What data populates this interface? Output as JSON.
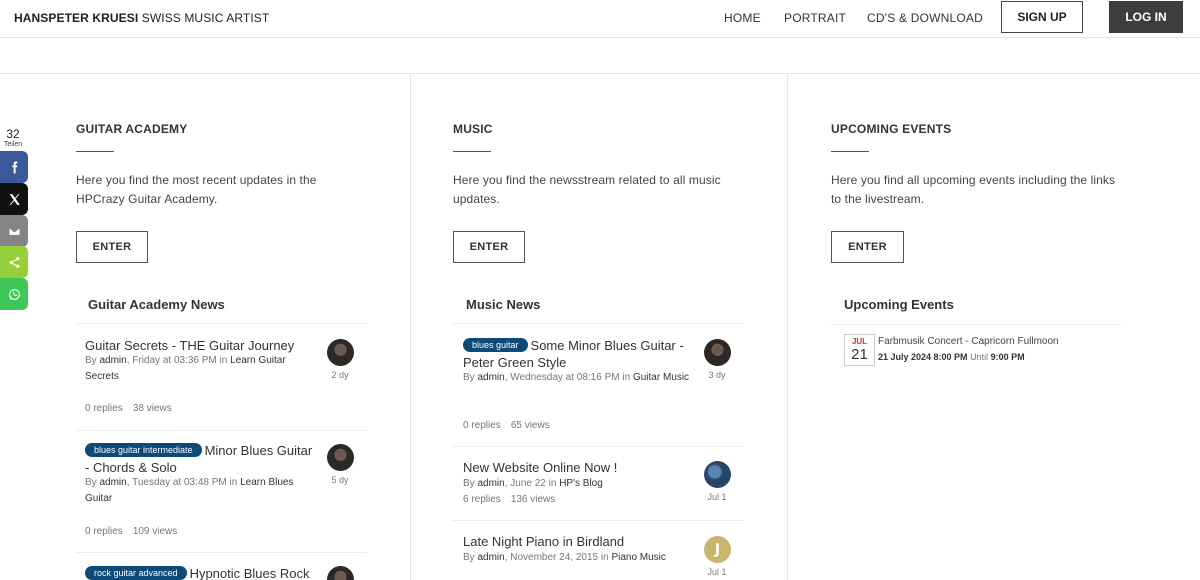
{
  "header": {
    "brand_bold": "HANSPETER KRUESI",
    "brand_rest": " SWISS MUSIC ARTIST",
    "nav": [
      "HOME",
      "PORTRAIT",
      "CD'S & DOWNLOAD"
    ],
    "signup": "SIGN UP",
    "login": "LOG IN"
  },
  "share": {
    "count": "32",
    "label": "Teilen",
    "buttons": [
      {
        "name": "facebook",
        "color": "#3b5998"
      },
      {
        "name": "x",
        "color": "#111111"
      },
      {
        "name": "email",
        "color": "#848484"
      },
      {
        "name": "share",
        "color": "#95d03a"
      },
      {
        "name": "whatsapp",
        "color": "#3ec757"
      }
    ]
  },
  "sections": [
    {
      "title": "GUITAR ACADEMY",
      "desc": "Here you find the most recent updates in the HPCrazy Guitar Academy.",
      "enter": "ENTER",
      "news_title": "Guitar Academy News",
      "items": [
        {
          "tag": "",
          "title": "Guitar Secrets - THE Guitar Journey",
          "by": "By ",
          "author": "admin",
          "when": ", Friday at 03:36 PM",
          "in": " in ",
          "forum": "Learn Guitar Secrets",
          "replies": "0 replies",
          "views": "38 views",
          "age": "2 dy"
        },
        {
          "tag": "blues guitar intermediate",
          "title": "Minor Blues Guitar - Chords & Solo",
          "by": "By ",
          "author": "admin",
          "when": ", Tuesday at 03:48 PM",
          "in": " in ",
          "forum": "Learn Blues Guitar",
          "replies": "0 replies",
          "views": "109 views",
          "age": "5 dy"
        },
        {
          "tag": "rock guitar advanced",
          "title": "Hypnotic Blues Rock",
          "by": "",
          "author": "",
          "when": "",
          "in": "",
          "forum": "",
          "replies": "",
          "views": "",
          "age": ""
        }
      ]
    },
    {
      "title": "MUSIC",
      "desc": "Here you find the newsstream related to all music updates.",
      "enter": "ENTER",
      "news_title": "Music News",
      "items": [
        {
          "tag": "blues guitar",
          "title": "Some Minor Blues Guitar - Peter Green Style",
          "by": "By ",
          "author": "admin",
          "when": ", Wednesday at 08:16 PM",
          "in": " in ",
          "forum": "Guitar Music",
          "replies": "0 replies",
          "views": "65 views",
          "age": "3 dy"
        },
        {
          "tag": "",
          "title": "New Website Online Now !",
          "by": "By ",
          "author": "admin",
          "when": ", June 22",
          "in": " in ",
          "forum": "HP's Blog",
          "replies": "6 replies",
          "views": "136 views",
          "age": "Jul 1"
        },
        {
          "tag": "",
          "title": "Late Night Piano in Birdland",
          "by": "By ",
          "author": "admin",
          "when": ", November 24, 2015",
          "in": " in ",
          "forum": "Piano Music",
          "replies": "",
          "views": "",
          "age": "Jul 1",
          "avatar_letter": "J"
        }
      ]
    },
    {
      "title": "UPCOMING EVENTS",
      "desc": "Here you find all upcoming events including the links to the livestream.",
      "enter": "ENTER",
      "news_title": "Upcoming Events",
      "event": {
        "month": "JUL",
        "day": "21",
        "title": "Farbmusik Concert - Capricorn Fullmoon",
        "start": "21 July 2024 8:00 PM",
        "until": " Until ",
        "end": "9:00 PM"
      }
    }
  ]
}
